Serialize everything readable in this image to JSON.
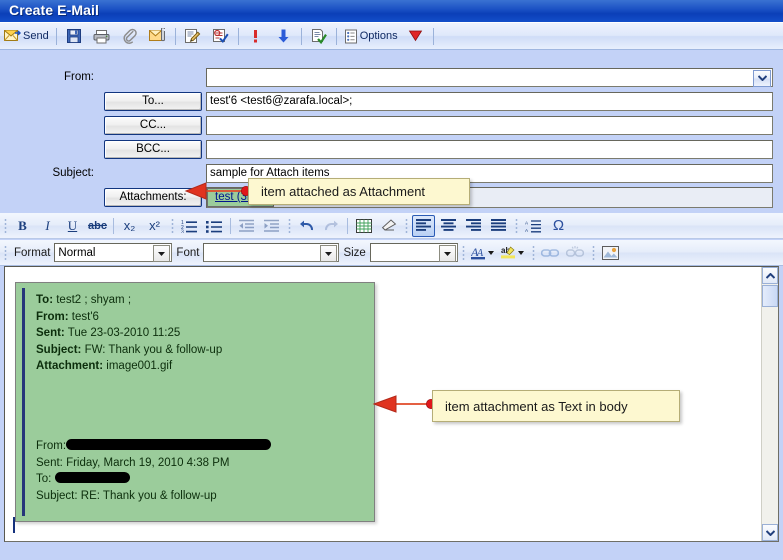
{
  "window": {
    "title": "Create E-Mail"
  },
  "toolbar": {
    "send_label": "Send",
    "options_label": "Options",
    "items": [
      {
        "name": "send-icon",
        "label": "Send"
      },
      {
        "name": "save-icon",
        "label": "Save"
      },
      {
        "name": "print-icon",
        "label": "Print"
      },
      {
        "name": "paperclip-icon",
        "label": "Attach File"
      },
      {
        "name": "attach-item-icon",
        "label": "Attach Item"
      },
      {
        "name": "signature-icon",
        "label": "Insert Signature"
      },
      {
        "name": "check-names-icon",
        "label": "Check Names"
      },
      {
        "name": "high-priority-icon",
        "label": "High Priority"
      },
      {
        "name": "low-priority-icon",
        "label": "Low Priority"
      },
      {
        "name": "read-receipt-icon",
        "label": "Request Read Receipt"
      },
      {
        "name": "options-icon",
        "label": "Options"
      },
      {
        "name": "flag-icon",
        "label": "Follow Up Flag"
      }
    ]
  },
  "fields": {
    "from_label": "From:",
    "from_value": "",
    "to_label": "To...",
    "to_value": "test'6 <test6@zarafa.local>;",
    "cc_label": "CC...",
    "cc_value": "",
    "bcc_label": "BCC...",
    "bcc_value": "",
    "subject_label": "Subject:",
    "subject_value": "sample for Attach items",
    "attachments_label": "Attachments:",
    "attachment_chip": "test (3kb);"
  },
  "editor_toolbar": {
    "bold": "B",
    "italic": "I",
    "underline": "U",
    "strikethrough": "abc",
    "subscript": "x₂",
    "superscript": "x²",
    "omega": "Ω",
    "format_label": "Format",
    "format_value": "Normal",
    "font_label": "Font",
    "font_value": "",
    "size_label": "Size",
    "size_value": "",
    "buttons": [
      {
        "name": "bold-button"
      },
      {
        "name": "italic-button"
      },
      {
        "name": "underline-button"
      },
      {
        "name": "strikethrough-button"
      },
      {
        "name": "subscript-button"
      },
      {
        "name": "superscript-button"
      },
      {
        "name": "numbered-list-button"
      },
      {
        "name": "bulleted-list-button"
      },
      {
        "name": "decrease-indent-button"
      },
      {
        "name": "increase-indent-button"
      },
      {
        "name": "undo-button"
      },
      {
        "name": "redo-button"
      },
      {
        "name": "insert-table-button"
      },
      {
        "name": "remove-format-button"
      },
      {
        "name": "align-left-button"
      },
      {
        "name": "align-center-button"
      },
      {
        "name": "align-right-button"
      },
      {
        "name": "align-justify-button"
      },
      {
        "name": "line-spacing-button"
      },
      {
        "name": "special-character-button"
      },
      {
        "name": "font-color-button"
      },
      {
        "name": "highlight-color-button"
      },
      {
        "name": "insert-link-button"
      },
      {
        "name": "remove-link-button"
      },
      {
        "name": "insert-image-button"
      }
    ]
  },
  "body": {
    "quote_header": {
      "to_label": "To:",
      "to_value": "test2 ; shyam ;",
      "from_label": "From:",
      "from_value": "test'6",
      "sent_label": "Sent:",
      "sent_value": "Tue 23-03-2010 11:25",
      "subject_label": "Subject:",
      "subject_value": "FW: Thank you & follow-up",
      "attachment_label": "Attachment:",
      "attachment_value": "image001.gif"
    },
    "quote_inner": {
      "from_label": "From:",
      "from_value": "",
      "sent_label": "Sent:",
      "sent_value": "Friday, March 19, 2010 4:38 PM",
      "to_label": "To:",
      "to_value": "",
      "subject_label": "Subject:",
      "subject_value": "RE: Thank you & follow-up"
    }
  },
  "annotations": {
    "callout1": "item attached as Attachment",
    "callout2": "item attachment as Text in body"
  },
  "colors": {
    "titlebar": "#1b51c4",
    "field_background": "#c3d2f7",
    "quote_green": "#9bcc9b",
    "callout_yellow": "#fdf8d0",
    "annotation_red": "#e03a2a",
    "link_blue": "#00148c"
  }
}
